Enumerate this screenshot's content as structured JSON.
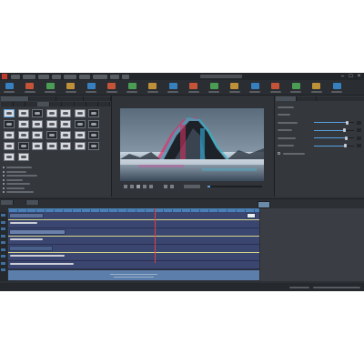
{
  "app": {
    "title": ""
  },
  "menu": {
    "items": [
      "",
      "",
      "",
      "",
      "",
      "",
      "",
      "",
      ""
    ]
  },
  "toolbar": {
    "buttons": [
      {
        "icon": "new-project-icon",
        "label": ""
      },
      {
        "icon": "open-icon",
        "label": ""
      },
      {
        "icon": "save-icon",
        "label": ""
      },
      {
        "icon": "undo-icon",
        "label": ""
      },
      {
        "icon": "redo-icon",
        "label": ""
      },
      {
        "icon": "import-icon",
        "label": ""
      },
      {
        "icon": "export-icon",
        "label": ""
      },
      {
        "icon": "record-icon",
        "label": ""
      },
      {
        "icon": "cut-icon",
        "label": ""
      },
      {
        "icon": "text-icon",
        "label": ""
      },
      {
        "icon": "effects-icon",
        "label": ""
      },
      {
        "icon": "transition-icon",
        "label": ""
      },
      {
        "icon": "audio-icon",
        "label": ""
      },
      {
        "icon": "media-pool-icon",
        "label": ""
      },
      {
        "icon": "burn-disc-icon",
        "label": ""
      },
      {
        "icon": "share-icon",
        "label": ""
      },
      {
        "icon": "help-icon",
        "label": ""
      }
    ],
    "accent_colors": [
      "#3a8fd8",
      "#e05a3a",
      "#4fb35a",
      "#d8a23a"
    ]
  },
  "effects_panel": {
    "tabs": [
      "",
      "",
      "",
      ""
    ],
    "subtabs": [
      "",
      "",
      "",
      "",
      "",
      "",
      "",
      "",
      ""
    ],
    "thumbnails": 30,
    "list_items": [
      "",
      "",
      "",
      "",
      "",
      "",
      ""
    ]
  },
  "preview": {
    "title": "",
    "progress": 0.05
  },
  "properties": {
    "tabs": [
      "",
      ""
    ],
    "rows": [
      {
        "label": "",
        "kind": "header"
      },
      {
        "label": "",
        "kind": "text"
      },
      {
        "label": "",
        "kind": "slider",
        "value": 0.82
      },
      {
        "label": "",
        "kind": "slider",
        "value": 0.77
      },
      {
        "label": "",
        "kind": "slider",
        "value": 0.8
      },
      {
        "label": "",
        "kind": "slider",
        "value": 0.78
      },
      {
        "label": "",
        "kind": "checkbox"
      }
    ]
  },
  "timeline": {
    "tabs": [
      "",
      "",
      ""
    ],
    "track_count": 9,
    "footer_text": [
      "",
      ""
    ]
  },
  "status": {
    "left": "",
    "right": ""
  },
  "colors": {
    "background": "#2f3338",
    "accent": "#5aa0e0",
    "track_blue": "#3a4570",
    "track_yellow": "#d4d68a",
    "logo": "#c0392b"
  }
}
